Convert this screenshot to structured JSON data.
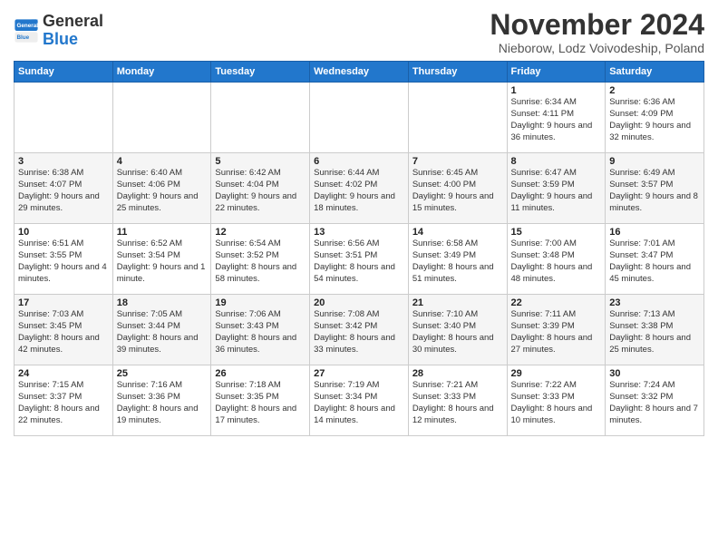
{
  "header": {
    "logo": {
      "general": "General",
      "blue": "Blue"
    },
    "title": "November 2024",
    "subtitle": "Nieborow, Lodz Voivodeship, Poland"
  },
  "calendar": {
    "days_of_week": [
      "Sunday",
      "Monday",
      "Tuesday",
      "Wednesday",
      "Thursday",
      "Friday",
      "Saturday"
    ],
    "weeks": [
      [
        {
          "day": "",
          "info": ""
        },
        {
          "day": "",
          "info": ""
        },
        {
          "day": "",
          "info": ""
        },
        {
          "day": "",
          "info": ""
        },
        {
          "day": "",
          "info": ""
        },
        {
          "day": "1",
          "info": "Sunrise: 6:34 AM\nSunset: 4:11 PM\nDaylight: 9 hours\nand 36 minutes."
        },
        {
          "day": "2",
          "info": "Sunrise: 6:36 AM\nSunset: 4:09 PM\nDaylight: 9 hours\nand 32 minutes."
        }
      ],
      [
        {
          "day": "3",
          "info": "Sunrise: 6:38 AM\nSunset: 4:07 PM\nDaylight: 9 hours\nand 29 minutes."
        },
        {
          "day": "4",
          "info": "Sunrise: 6:40 AM\nSunset: 4:06 PM\nDaylight: 9 hours\nand 25 minutes."
        },
        {
          "day": "5",
          "info": "Sunrise: 6:42 AM\nSunset: 4:04 PM\nDaylight: 9 hours\nand 22 minutes."
        },
        {
          "day": "6",
          "info": "Sunrise: 6:44 AM\nSunset: 4:02 PM\nDaylight: 9 hours\nand 18 minutes."
        },
        {
          "day": "7",
          "info": "Sunrise: 6:45 AM\nSunset: 4:00 PM\nDaylight: 9 hours\nand 15 minutes."
        },
        {
          "day": "8",
          "info": "Sunrise: 6:47 AM\nSunset: 3:59 PM\nDaylight: 9 hours\nand 11 minutes."
        },
        {
          "day": "9",
          "info": "Sunrise: 6:49 AM\nSunset: 3:57 PM\nDaylight: 9 hours\nand 8 minutes."
        }
      ],
      [
        {
          "day": "10",
          "info": "Sunrise: 6:51 AM\nSunset: 3:55 PM\nDaylight: 9 hours\nand 4 minutes."
        },
        {
          "day": "11",
          "info": "Sunrise: 6:52 AM\nSunset: 3:54 PM\nDaylight: 9 hours\nand 1 minute."
        },
        {
          "day": "12",
          "info": "Sunrise: 6:54 AM\nSunset: 3:52 PM\nDaylight: 8 hours\nand 58 minutes."
        },
        {
          "day": "13",
          "info": "Sunrise: 6:56 AM\nSunset: 3:51 PM\nDaylight: 8 hours\nand 54 minutes."
        },
        {
          "day": "14",
          "info": "Sunrise: 6:58 AM\nSunset: 3:49 PM\nDaylight: 8 hours\nand 51 minutes."
        },
        {
          "day": "15",
          "info": "Sunrise: 7:00 AM\nSunset: 3:48 PM\nDaylight: 8 hours\nand 48 minutes."
        },
        {
          "day": "16",
          "info": "Sunrise: 7:01 AM\nSunset: 3:47 PM\nDaylight: 8 hours\nand 45 minutes."
        }
      ],
      [
        {
          "day": "17",
          "info": "Sunrise: 7:03 AM\nSunset: 3:45 PM\nDaylight: 8 hours\nand 42 minutes."
        },
        {
          "day": "18",
          "info": "Sunrise: 7:05 AM\nSunset: 3:44 PM\nDaylight: 8 hours\nand 39 minutes."
        },
        {
          "day": "19",
          "info": "Sunrise: 7:06 AM\nSunset: 3:43 PM\nDaylight: 8 hours\nand 36 minutes."
        },
        {
          "day": "20",
          "info": "Sunrise: 7:08 AM\nSunset: 3:42 PM\nDaylight: 8 hours\nand 33 minutes."
        },
        {
          "day": "21",
          "info": "Sunrise: 7:10 AM\nSunset: 3:40 PM\nDaylight: 8 hours\nand 30 minutes."
        },
        {
          "day": "22",
          "info": "Sunrise: 7:11 AM\nSunset: 3:39 PM\nDaylight: 8 hours\nand 27 minutes."
        },
        {
          "day": "23",
          "info": "Sunrise: 7:13 AM\nSunset: 3:38 PM\nDaylight: 8 hours\nand 25 minutes."
        }
      ],
      [
        {
          "day": "24",
          "info": "Sunrise: 7:15 AM\nSunset: 3:37 PM\nDaylight: 8 hours\nand 22 minutes."
        },
        {
          "day": "25",
          "info": "Sunrise: 7:16 AM\nSunset: 3:36 PM\nDaylight: 8 hours\nand 19 minutes."
        },
        {
          "day": "26",
          "info": "Sunrise: 7:18 AM\nSunset: 3:35 PM\nDaylight: 8 hours\nand 17 minutes."
        },
        {
          "day": "27",
          "info": "Sunrise: 7:19 AM\nSunset: 3:34 PM\nDaylight: 8 hours\nand 14 minutes."
        },
        {
          "day": "28",
          "info": "Sunrise: 7:21 AM\nSunset: 3:33 PM\nDaylight: 8 hours\nand 12 minutes."
        },
        {
          "day": "29",
          "info": "Sunrise: 7:22 AM\nSunset: 3:33 PM\nDaylight: 8 hours\nand 10 minutes."
        },
        {
          "day": "30",
          "info": "Sunrise: 7:24 AM\nSunset: 3:32 PM\nDaylight: 8 hours\nand 7 minutes."
        }
      ]
    ]
  }
}
